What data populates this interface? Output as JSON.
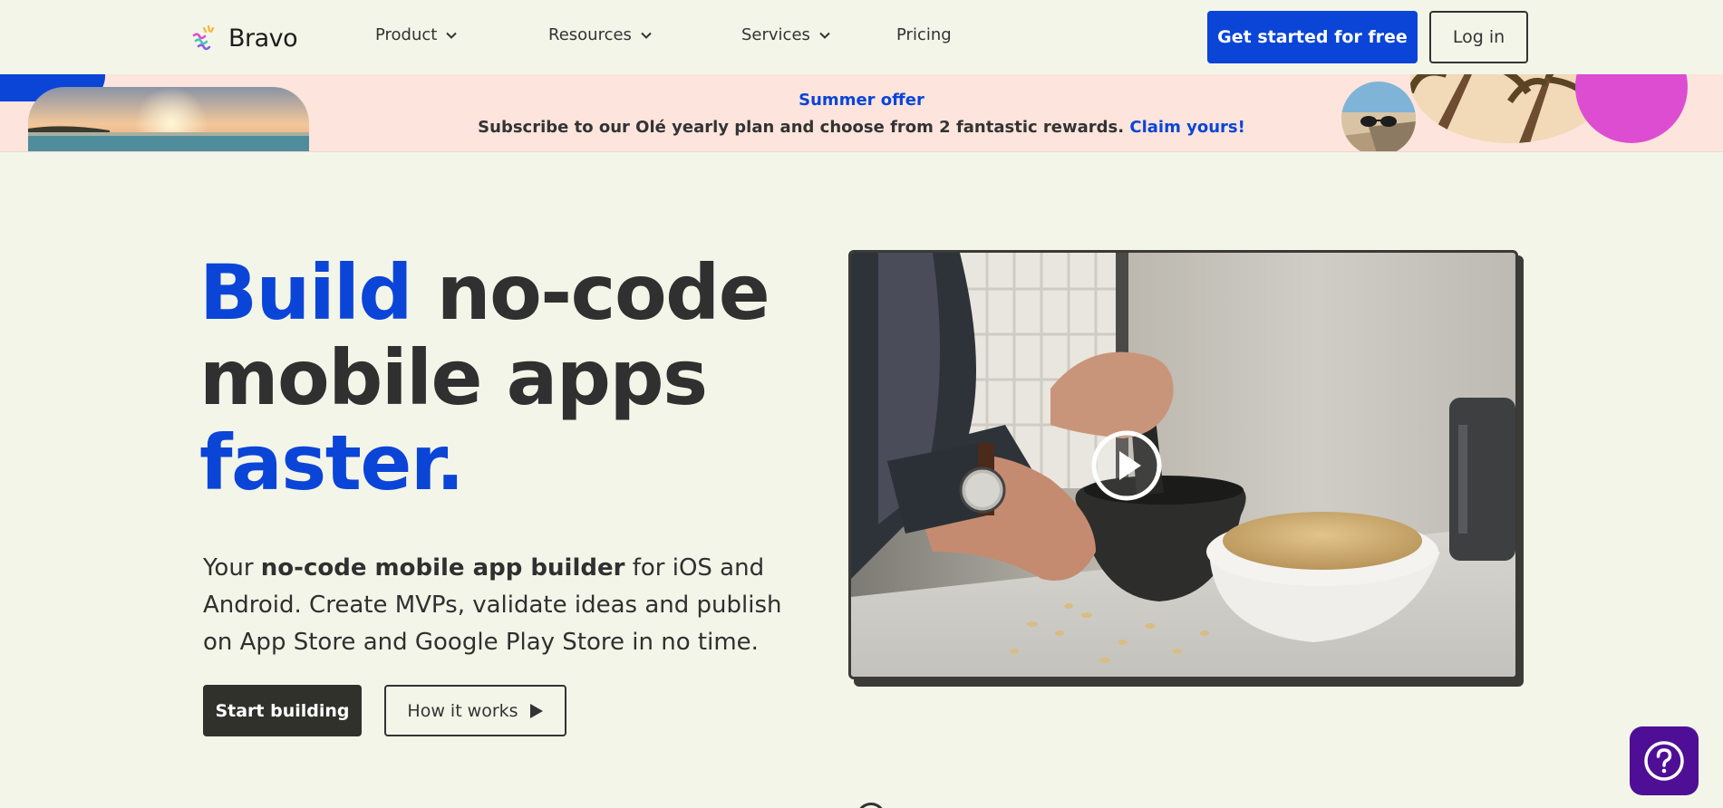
{
  "header": {
    "logo_text": "Bravo",
    "nav": [
      {
        "label": "Product",
        "has_dropdown": true
      },
      {
        "label": "Resources",
        "has_dropdown": true
      },
      {
        "label": "Services",
        "has_dropdown": true
      },
      {
        "label": "Pricing",
        "has_dropdown": false
      }
    ],
    "cta_label": "Get started for free",
    "login_label": "Log in"
  },
  "banner": {
    "title": "Summer offer",
    "text": "Subscribe to our Olé yearly plan and choose from 2 fantastic rewards.",
    "link_label": "Claim yours!"
  },
  "hero": {
    "title_part1": "Build",
    "title_part2": " no-code",
    "title_line2": "mobile apps",
    "title_line3": "faster.",
    "desc_part1": "Your ",
    "desc_bold": "no-code mobile app builder",
    "desc_part2": " for iOS and Android. Create MVPs, validate ideas and publish on App Store and Google Play Store in no time.",
    "start_label": "Start building",
    "how_label": "How it works"
  },
  "video": {
    "icon": "play-circle-icon"
  },
  "help": {
    "icon": "question-mark-icon"
  },
  "colors": {
    "background": "#f3f5e8",
    "brand_blue": "#0b45d8",
    "banner_bg": "#fde4dc",
    "dark": "#31312c",
    "help_purple": "#4e0f96",
    "accent_pink": "#dc4dd1"
  }
}
